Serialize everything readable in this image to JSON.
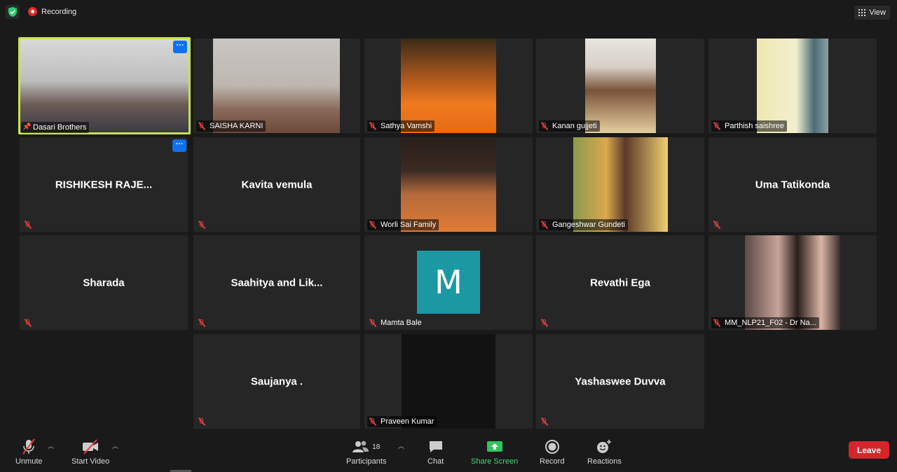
{
  "topbar": {
    "recording_label": "Recording",
    "view_label": "View"
  },
  "tiles": {
    "t00": {
      "name": "Dasari Brothers"
    },
    "t01": {
      "name": "SAISHA KARNI"
    },
    "t02": {
      "name": "Sathya Vamshi"
    },
    "t03": {
      "name": "Kanan gujjeti"
    },
    "t04": {
      "name": "Parthish saishree"
    },
    "t10": {
      "name": "RISHIKESH  RAJE..."
    },
    "t11": {
      "name": "Kavita vemula"
    },
    "t12": {
      "name": "Worli Sai Family"
    },
    "t13": {
      "name": "Gangeshwar Gundeti"
    },
    "t14": {
      "name": "Uma Tatikonda"
    },
    "t20": {
      "name": "Sharada"
    },
    "t21": {
      "name": "Saahitya  and  Lik..."
    },
    "t22": {
      "name": "Mamta Bale",
      "avatar_letter": "M"
    },
    "t23": {
      "name": "Revathi Ega"
    },
    "t24": {
      "name": "MM_NLP21_F02 - Dr Na..."
    },
    "t31": {
      "name": "Saujanya ."
    },
    "t32": {
      "name": "Praveen Kumar"
    },
    "t33": {
      "name": "Yashaswee Duvva"
    }
  },
  "toolbar": {
    "unmute": "Unmute",
    "start_video": "Start Video",
    "participants": "Participants",
    "participants_count": "18",
    "chat": "Chat",
    "share_screen": "Share Screen",
    "record": "Record",
    "reactions": "Reactions",
    "leave": "Leave"
  },
  "colors": {
    "active_speaker": "#c8e34a",
    "share_green": "#4cd67a",
    "leave_red": "#d5252b",
    "avatar_teal": "#1c98a3"
  }
}
